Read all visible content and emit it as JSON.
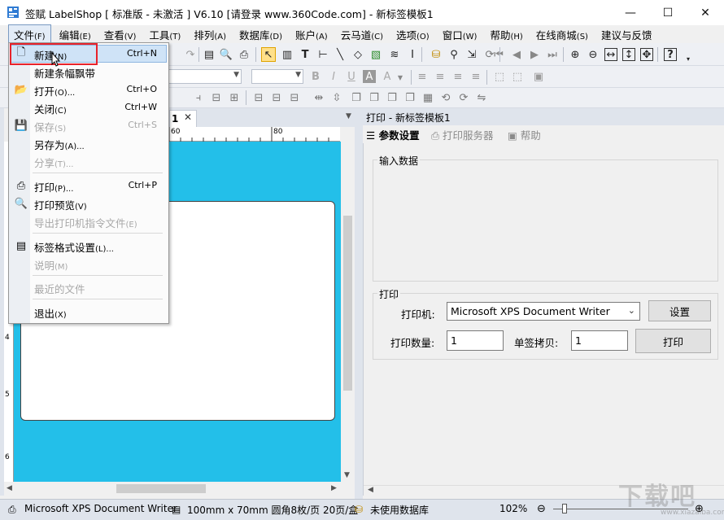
{
  "window": {
    "title": "签赋 LabelShop [ 标准版 - 未激活 ]  V6.10  [请登录 www.360Code.com] - 新标签模板1",
    "minimize": "—",
    "maximize": "☐",
    "close": "✕"
  },
  "menubar": [
    {
      "label": "文件",
      "accel": "(F)"
    },
    {
      "label": "编辑",
      "accel": "(E)"
    },
    {
      "label": "查看",
      "accel": "(V)"
    },
    {
      "label": "工具",
      "accel": "(T)"
    },
    {
      "label": "排列",
      "accel": "(A)"
    },
    {
      "label": "数据库",
      "accel": "(D)"
    },
    {
      "label": "账户",
      "accel": "(A)"
    },
    {
      "label": "云马道",
      "accel": "(C)"
    },
    {
      "label": "选项",
      "accel": "(O)"
    },
    {
      "label": "窗口",
      "accel": "(W)"
    },
    {
      "label": "帮助",
      "accel": "(H)"
    },
    {
      "label": "在线商城",
      "accel": "(S)"
    },
    {
      "label": "建议与反馈",
      "accel": ""
    }
  ],
  "file_menu": {
    "items": [
      {
        "label": "新建",
        "accel": "(N)",
        "shortcut": "Ctrl+N"
      },
      {
        "label": "新建条幅飘带",
        "accel": "",
        "shortcut": ""
      },
      {
        "label": "打开",
        "accel": "(O)...",
        "shortcut": "Ctrl+O"
      },
      {
        "label": "关闭",
        "accel": "(C)",
        "shortcut": "Ctrl+W"
      },
      {
        "label": "保存",
        "accel": "(S)",
        "shortcut": "Ctrl+S"
      },
      {
        "label": "另存为",
        "accel": "(A)...",
        "shortcut": ""
      },
      {
        "label": "分享",
        "accel": "(T)...",
        "shortcut": ""
      },
      {
        "label": "打印",
        "accel": "(P)...",
        "shortcut": "Ctrl+P"
      },
      {
        "label": "打印预览",
        "accel": "(V)",
        "shortcut": ""
      },
      {
        "label": "导出打印机指令文件",
        "accel": "(E)",
        "shortcut": ""
      },
      {
        "label": "标签格式设置",
        "accel": "(L)...",
        "shortcut": ""
      },
      {
        "label": "说明",
        "accel": "(M)",
        "shortcut": ""
      },
      {
        "label": "最近的文件",
        "accel": "",
        "shortcut": ""
      },
      {
        "label": "退出",
        "accel": "(X)",
        "shortcut": ""
      }
    ]
  },
  "document": {
    "tab_label": "1",
    "tab_close": "✕",
    "ruler_top_ticks": [
      "60",
      "80"
    ],
    "ruler_left_ticks": [
      "4",
      "5",
      "6"
    ]
  },
  "print_panel": {
    "title": "打印 - 新标签模板1",
    "tabs": {
      "params": "参数设置",
      "server": "打印服务器",
      "help": "帮助"
    },
    "input_group_title": "输入数据",
    "print_group_title": "打印",
    "printer_label": "打印机:",
    "printer_value": "Microsoft XPS Document Writer",
    "settings_button": "设置",
    "quantity_label": "打印数量:",
    "quantity_value": "1",
    "copies_label": "单签拷贝:",
    "copies_value": "1",
    "print_button": "打印"
  },
  "statusbar": {
    "printer": "Microsoft XPS Document Writer",
    "label_info": "100mm x 70mm 圆角8枚/页 20页/盒",
    "database": "未使用数据库",
    "zoom": "102%"
  },
  "watermark": {
    "text": "下载吧",
    "url": "www.xiazaiba.com"
  },
  "colors": {
    "canvas_bg": "#23bfe9",
    "highlight_box": "#e8222a",
    "menu_hover": "#cfe3f7"
  }
}
